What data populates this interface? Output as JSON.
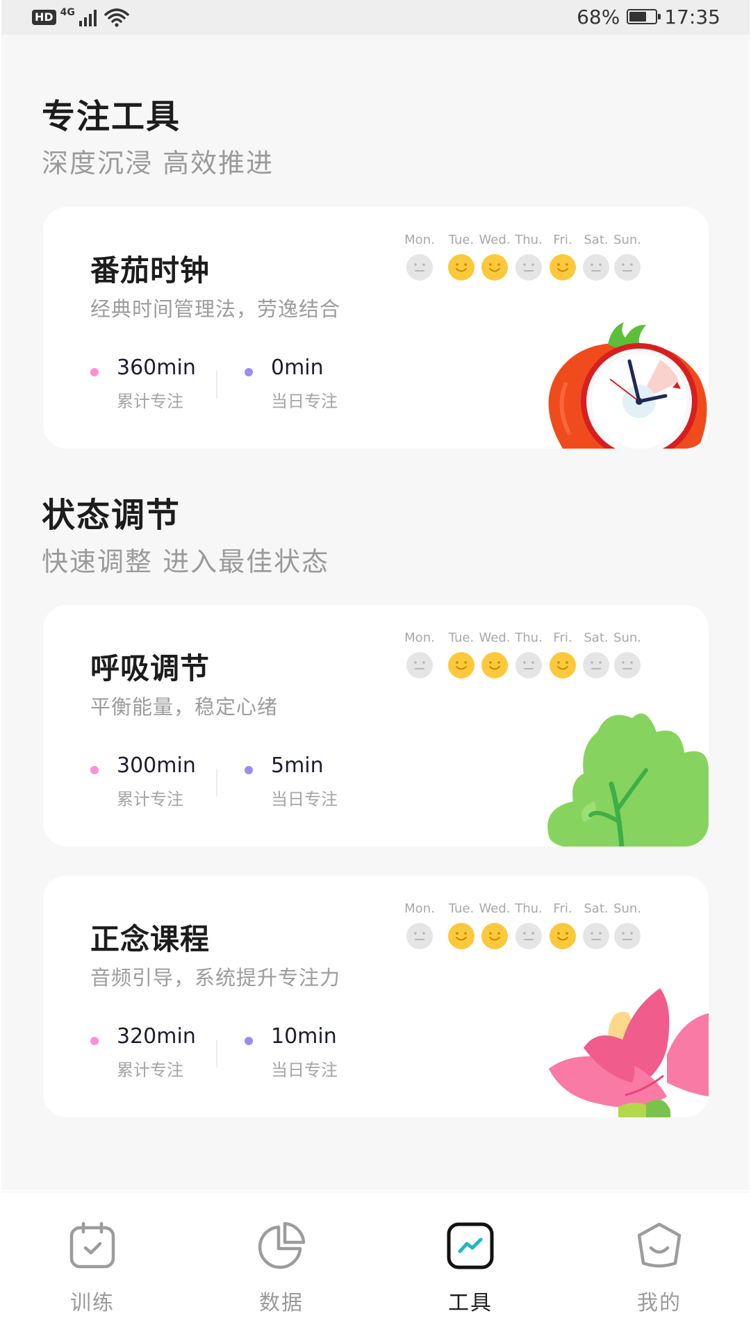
{
  "status_bar": {
    "network_badge": "HD",
    "network_type": "4G",
    "battery_percent_text": "68%",
    "battery_level": 0.68,
    "time": "17:35"
  },
  "sections": {
    "focus": {
      "title": "专注工具",
      "subtitle": "深度沉浸  高效推进"
    },
    "state": {
      "title": "状态调节",
      "subtitle": "快速调整  进入最佳状态"
    }
  },
  "week_labels": [
    "Mon.",
    "Tue.",
    "Wed.",
    "Thu.",
    "Fri.",
    "Sat.",
    "Sun."
  ],
  "cards": [
    {
      "title": "番茄时钟",
      "desc": "经典时间管理法，劳逸结合",
      "total_value": "360min",
      "total_label": "累计专注",
      "today_value": "0min",
      "today_label": "当日专注",
      "week_done": [
        false,
        true,
        true,
        false,
        true,
        false,
        false
      ],
      "illustration": "tomato-clock"
    },
    {
      "title": "呼吸调节",
      "desc": "平衡能量，稳定心绪",
      "total_value": "300min",
      "total_label": "累计专注",
      "today_value": "5min",
      "today_label": "当日专注",
      "week_done": [
        false,
        true,
        true,
        false,
        true,
        false,
        false
      ],
      "illustration": "green-leaf"
    },
    {
      "title": "正念课程",
      "desc": "音频引导，系统提升专注力",
      "total_value": "320min",
      "total_label": "累计专注",
      "today_value": "10min",
      "today_label": "当日专注",
      "week_done": [
        false,
        true,
        true,
        false,
        true,
        false,
        false
      ],
      "illustration": "pink-lotus"
    }
  ],
  "nav": [
    {
      "label": "训练",
      "icon": "calendar-check-icon",
      "active": false
    },
    {
      "label": "数据",
      "icon": "pie-chart-icon",
      "active": false
    },
    {
      "label": "工具",
      "icon": "trend-line-icon",
      "active": true
    },
    {
      "label": "我的",
      "icon": "smile-face-icon",
      "active": false
    }
  ],
  "colors": {
    "page_bg": "#f7f7f7",
    "card_bg": "#ffffff",
    "total_dot": "#ff8fd6",
    "today_dot": "#9b8cf2",
    "face_on": "#fcc83c",
    "face_off": "#e5e5e5",
    "nav_active_accent": "#1fb8c3"
  }
}
